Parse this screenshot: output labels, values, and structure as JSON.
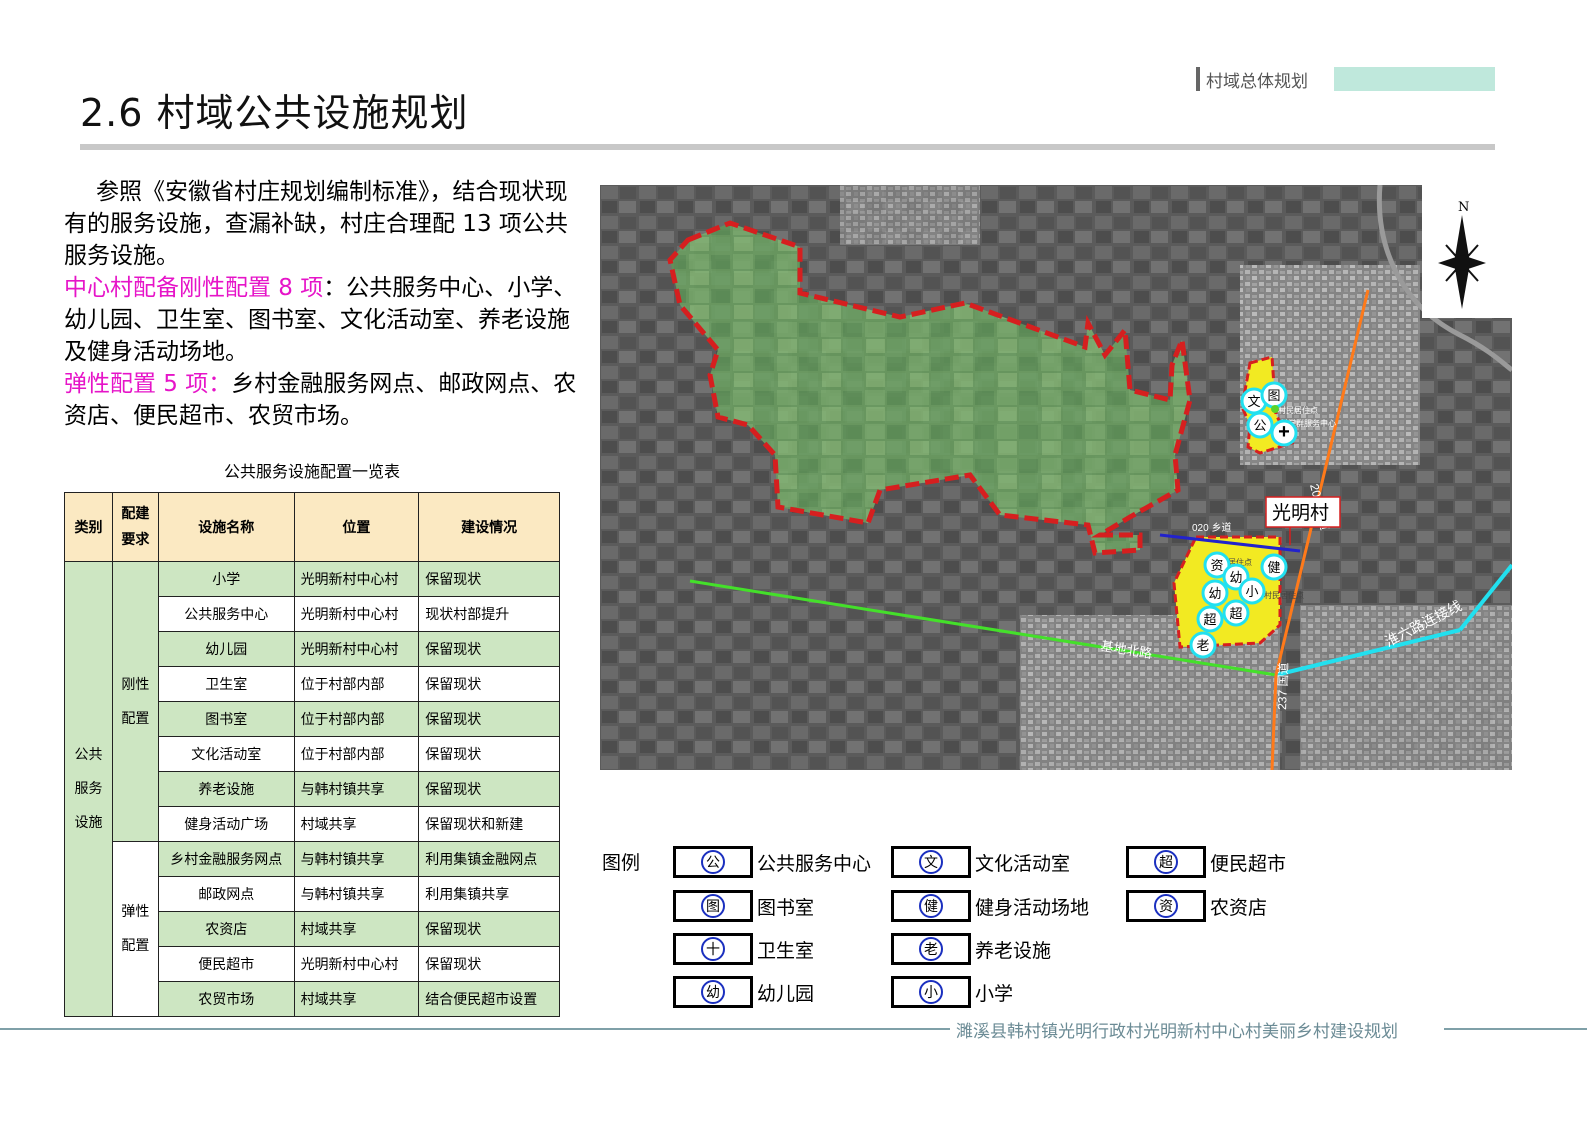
{
  "header": {
    "section_tag": "村域总体规划",
    "title": "2.6  村域公共设施规划"
  },
  "intro": {
    "p1": "参照《安徽省村庄规划编制标准》，结合现状现有的服务设施，查漏补缺，村庄合理配 13 项公共服务设施。",
    "p2_highlight": "中心村配备刚性配置 8 项",
    "p2_rest": "：公共服务中心、小学、幼儿园、卫生室、图书室、文化活动室、养老设施及健身活动场地。",
    "p3_highlight": "弹性配置 5 项：",
    "p3_rest": "乡村金融服务网点、邮政网点、农资店、便民超市、农贸市场。"
  },
  "table": {
    "caption": "公共服务设施配置一览表",
    "headers": [
      "类别",
      "配建要求",
      "设施名称",
      "位置",
      "建设情况"
    ],
    "category": "公共服务设施",
    "rigid_label": "刚性配置",
    "flexible_label": "弹性配置",
    "rigid_rows": [
      {
        "name": "小学",
        "location": "光明新村中心村",
        "status": "保留现状"
      },
      {
        "name": "公共服务中心",
        "location": "光明新村中心村",
        "status": "现状村部提升"
      },
      {
        "name": "幼儿园",
        "location": "光明新村中心村",
        "status": "保留现状"
      },
      {
        "name": "卫生室",
        "location": "位于村部内部",
        "status": "保留现状"
      },
      {
        "name": "图书室",
        "location": "位于村部内部",
        "status": "保留现状"
      },
      {
        "name": "文化活动室",
        "location": "位于村部内部",
        "status": "保留现状"
      },
      {
        "name": "养老设施",
        "location": "与韩村镇共享",
        "status": "保留现状"
      },
      {
        "name": "健身活动广场",
        "location": "村域共享",
        "status": "保留现状和新建"
      }
    ],
    "flexible_rows": [
      {
        "name": "乡村金融服务网点",
        "location": "与韩村镇共享",
        "status": "利用集镇金融网点"
      },
      {
        "name": "邮政网点",
        "location": "与韩村镇共享",
        "status": "利用集镇共享"
      },
      {
        "name": "农资店",
        "location": "村域共享",
        "status": "保留现状"
      },
      {
        "name": "便民超市",
        "location": "光明新村中心村",
        "status": "保留现状"
      },
      {
        "name": "农贸市场",
        "location": "村域共享",
        "status": "结合便民超市设置"
      }
    ]
  },
  "map": {
    "village_label": "光明村",
    "north": "N",
    "road_020": "020 乡道",
    "road_jidi": "基地北路",
    "road_huailiu": "淮六路连接线",
    "road_203": "203 省道",
    "road_237": "237 国道",
    "label_center": "村党群服务中心",
    "label_res1": "村民居住点",
    "label_res2": "村民居住点",
    "label_res3": "村民居住点",
    "markers": {
      "wen": "文",
      "tu": "图",
      "gong": "公",
      "plus": "+",
      "zi": "资",
      "you1": "幼",
      "jian": "健",
      "xiao": "小",
      "you2": "幼",
      "chao1": "超",
      "chao2": "超",
      "lao": "老"
    }
  },
  "legend": {
    "title": "图例",
    "items": [
      {
        "glyph": "公",
        "label": "公共服务中心"
      },
      {
        "glyph": "文",
        "label": "文化活动室"
      },
      {
        "glyph": "超",
        "label": "便民超市"
      },
      {
        "glyph": "图",
        "label": "图书室"
      },
      {
        "glyph": "健",
        "label": "健身活动场地"
      },
      {
        "glyph": "资",
        "label": "农资店"
      },
      {
        "glyph": "十",
        "label": "卫生室"
      },
      {
        "glyph": "老",
        "label": "养老设施"
      },
      {
        "glyph": "幼",
        "label": "幼儿园"
      },
      {
        "glyph": "小",
        "label": "小学"
      }
    ]
  },
  "footer": {
    "text": "濉溪县韩村镇光明行政村光明新村中心村美丽乡村建设规划"
  },
  "colors": {
    "highlight": "#e614c8",
    "table_header": "#fbe9c2",
    "table_green": "#cde6c2",
    "tag_fill": "#bfe8dc",
    "boundary": "#d61f1f",
    "legend_circle": "#1a2fbf"
  }
}
